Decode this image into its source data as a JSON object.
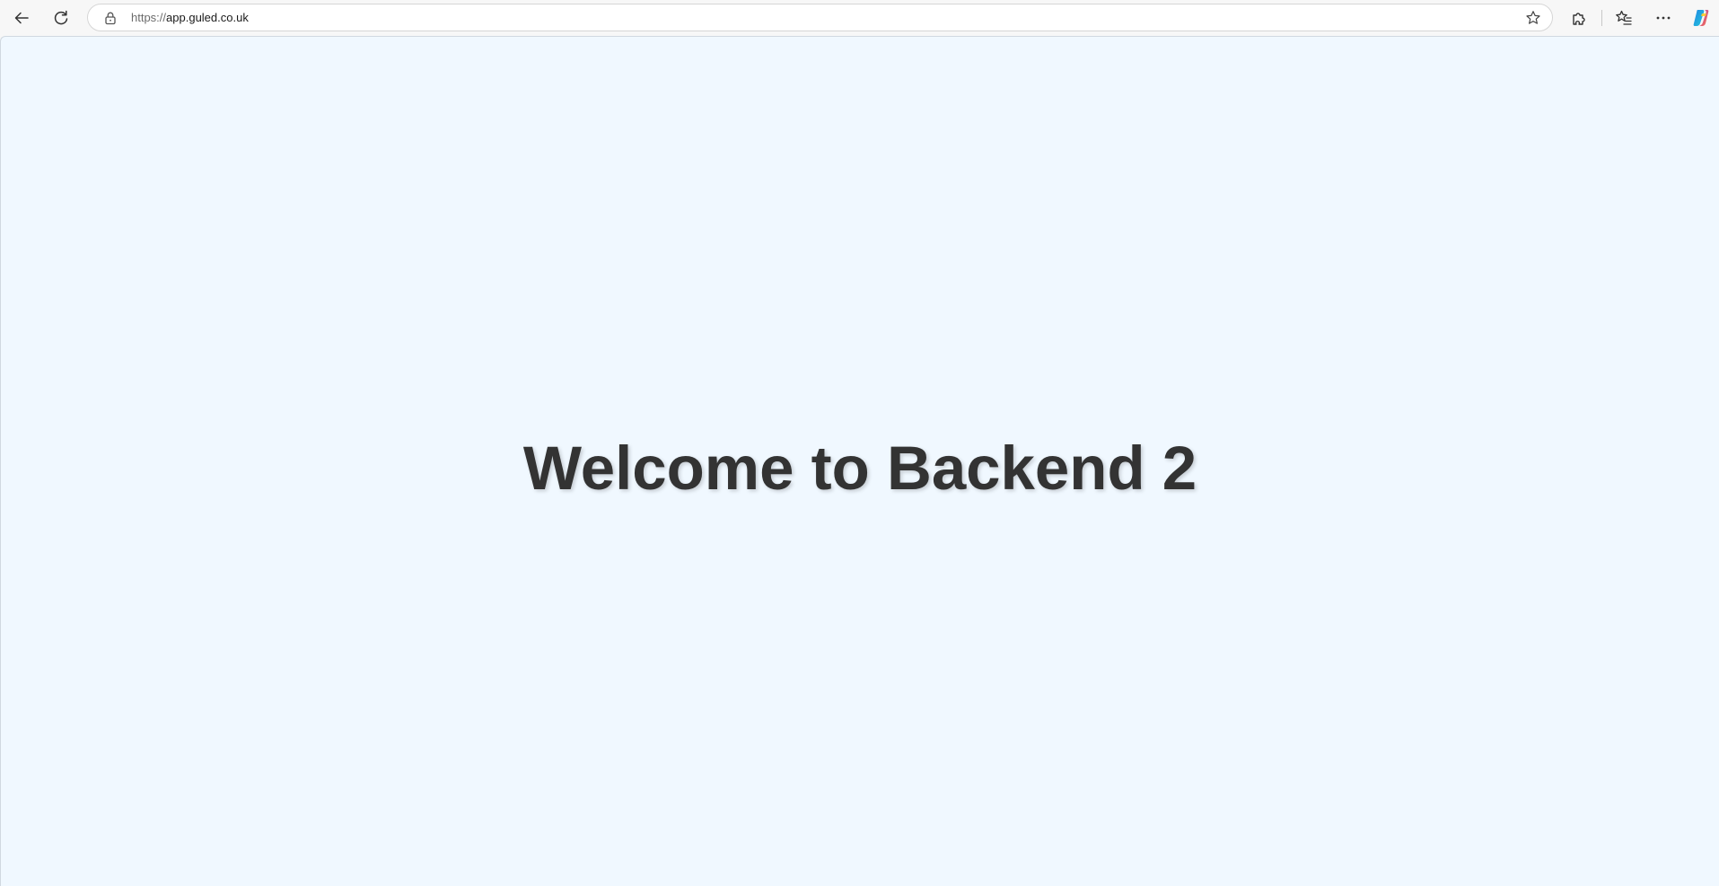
{
  "browser": {
    "address": {
      "scheme": "https://",
      "host": "app.guled.co.uk"
    },
    "toolbar": {
      "back_icon": "back-arrow-icon",
      "refresh_icon": "refresh-icon",
      "lock_icon": "lock-icon",
      "favorite_icon": "star-icon",
      "extensions_icon": "puzzle-icon",
      "favorites_icon": "favorites-list-icon",
      "more_icon": "more-dots-icon",
      "copilot_icon": "copilot-icon"
    }
  },
  "page": {
    "background_color": "#f0f8ff",
    "heading": "Welcome to Backend 2",
    "heading_color": "#333333"
  }
}
